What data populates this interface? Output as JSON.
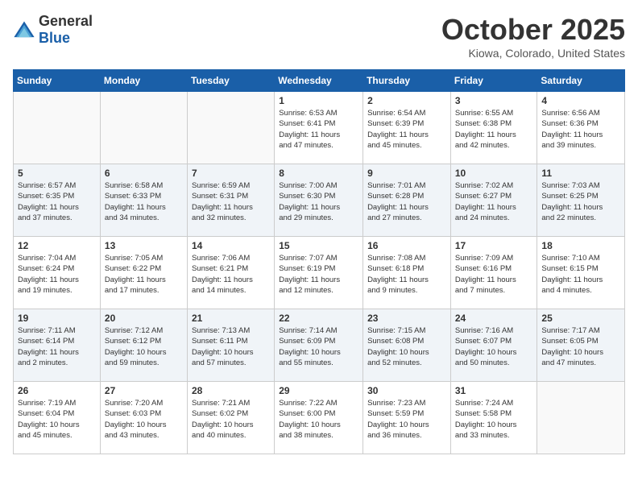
{
  "header": {
    "logo_general": "General",
    "logo_blue": "Blue",
    "month_title": "October 2025",
    "location": "Kiowa, Colorado, United States"
  },
  "weekdays": [
    "Sunday",
    "Monday",
    "Tuesday",
    "Wednesday",
    "Thursday",
    "Friday",
    "Saturday"
  ],
  "weeks": [
    [
      {
        "day": "",
        "content": ""
      },
      {
        "day": "",
        "content": ""
      },
      {
        "day": "",
        "content": ""
      },
      {
        "day": "1",
        "content": "Sunrise: 6:53 AM\nSunset: 6:41 PM\nDaylight: 11 hours\nand 47 minutes."
      },
      {
        "day": "2",
        "content": "Sunrise: 6:54 AM\nSunset: 6:39 PM\nDaylight: 11 hours\nand 45 minutes."
      },
      {
        "day": "3",
        "content": "Sunrise: 6:55 AM\nSunset: 6:38 PM\nDaylight: 11 hours\nand 42 minutes."
      },
      {
        "day": "4",
        "content": "Sunrise: 6:56 AM\nSunset: 6:36 PM\nDaylight: 11 hours\nand 39 minutes."
      }
    ],
    [
      {
        "day": "5",
        "content": "Sunrise: 6:57 AM\nSunset: 6:35 PM\nDaylight: 11 hours\nand 37 minutes."
      },
      {
        "day": "6",
        "content": "Sunrise: 6:58 AM\nSunset: 6:33 PM\nDaylight: 11 hours\nand 34 minutes."
      },
      {
        "day": "7",
        "content": "Sunrise: 6:59 AM\nSunset: 6:31 PM\nDaylight: 11 hours\nand 32 minutes."
      },
      {
        "day": "8",
        "content": "Sunrise: 7:00 AM\nSunset: 6:30 PM\nDaylight: 11 hours\nand 29 minutes."
      },
      {
        "day": "9",
        "content": "Sunrise: 7:01 AM\nSunset: 6:28 PM\nDaylight: 11 hours\nand 27 minutes."
      },
      {
        "day": "10",
        "content": "Sunrise: 7:02 AM\nSunset: 6:27 PM\nDaylight: 11 hours\nand 24 minutes."
      },
      {
        "day": "11",
        "content": "Sunrise: 7:03 AM\nSunset: 6:25 PM\nDaylight: 11 hours\nand 22 minutes."
      }
    ],
    [
      {
        "day": "12",
        "content": "Sunrise: 7:04 AM\nSunset: 6:24 PM\nDaylight: 11 hours\nand 19 minutes."
      },
      {
        "day": "13",
        "content": "Sunrise: 7:05 AM\nSunset: 6:22 PM\nDaylight: 11 hours\nand 17 minutes."
      },
      {
        "day": "14",
        "content": "Sunrise: 7:06 AM\nSunset: 6:21 PM\nDaylight: 11 hours\nand 14 minutes."
      },
      {
        "day": "15",
        "content": "Sunrise: 7:07 AM\nSunset: 6:19 PM\nDaylight: 11 hours\nand 12 minutes."
      },
      {
        "day": "16",
        "content": "Sunrise: 7:08 AM\nSunset: 6:18 PM\nDaylight: 11 hours\nand 9 minutes."
      },
      {
        "day": "17",
        "content": "Sunrise: 7:09 AM\nSunset: 6:16 PM\nDaylight: 11 hours\nand 7 minutes."
      },
      {
        "day": "18",
        "content": "Sunrise: 7:10 AM\nSunset: 6:15 PM\nDaylight: 11 hours\nand 4 minutes."
      }
    ],
    [
      {
        "day": "19",
        "content": "Sunrise: 7:11 AM\nSunset: 6:14 PM\nDaylight: 11 hours\nand 2 minutes."
      },
      {
        "day": "20",
        "content": "Sunrise: 7:12 AM\nSunset: 6:12 PM\nDaylight: 10 hours\nand 59 minutes."
      },
      {
        "day": "21",
        "content": "Sunrise: 7:13 AM\nSunset: 6:11 PM\nDaylight: 10 hours\nand 57 minutes."
      },
      {
        "day": "22",
        "content": "Sunrise: 7:14 AM\nSunset: 6:09 PM\nDaylight: 10 hours\nand 55 minutes."
      },
      {
        "day": "23",
        "content": "Sunrise: 7:15 AM\nSunset: 6:08 PM\nDaylight: 10 hours\nand 52 minutes."
      },
      {
        "day": "24",
        "content": "Sunrise: 7:16 AM\nSunset: 6:07 PM\nDaylight: 10 hours\nand 50 minutes."
      },
      {
        "day": "25",
        "content": "Sunrise: 7:17 AM\nSunset: 6:05 PM\nDaylight: 10 hours\nand 47 minutes."
      }
    ],
    [
      {
        "day": "26",
        "content": "Sunrise: 7:19 AM\nSunset: 6:04 PM\nDaylight: 10 hours\nand 45 minutes."
      },
      {
        "day": "27",
        "content": "Sunrise: 7:20 AM\nSunset: 6:03 PM\nDaylight: 10 hours\nand 43 minutes."
      },
      {
        "day": "28",
        "content": "Sunrise: 7:21 AM\nSunset: 6:02 PM\nDaylight: 10 hours\nand 40 minutes."
      },
      {
        "day": "29",
        "content": "Sunrise: 7:22 AM\nSunset: 6:00 PM\nDaylight: 10 hours\nand 38 minutes."
      },
      {
        "day": "30",
        "content": "Sunrise: 7:23 AM\nSunset: 5:59 PM\nDaylight: 10 hours\nand 36 minutes."
      },
      {
        "day": "31",
        "content": "Sunrise: 7:24 AM\nSunset: 5:58 PM\nDaylight: 10 hours\nand 33 minutes."
      },
      {
        "day": "",
        "content": ""
      }
    ]
  ]
}
